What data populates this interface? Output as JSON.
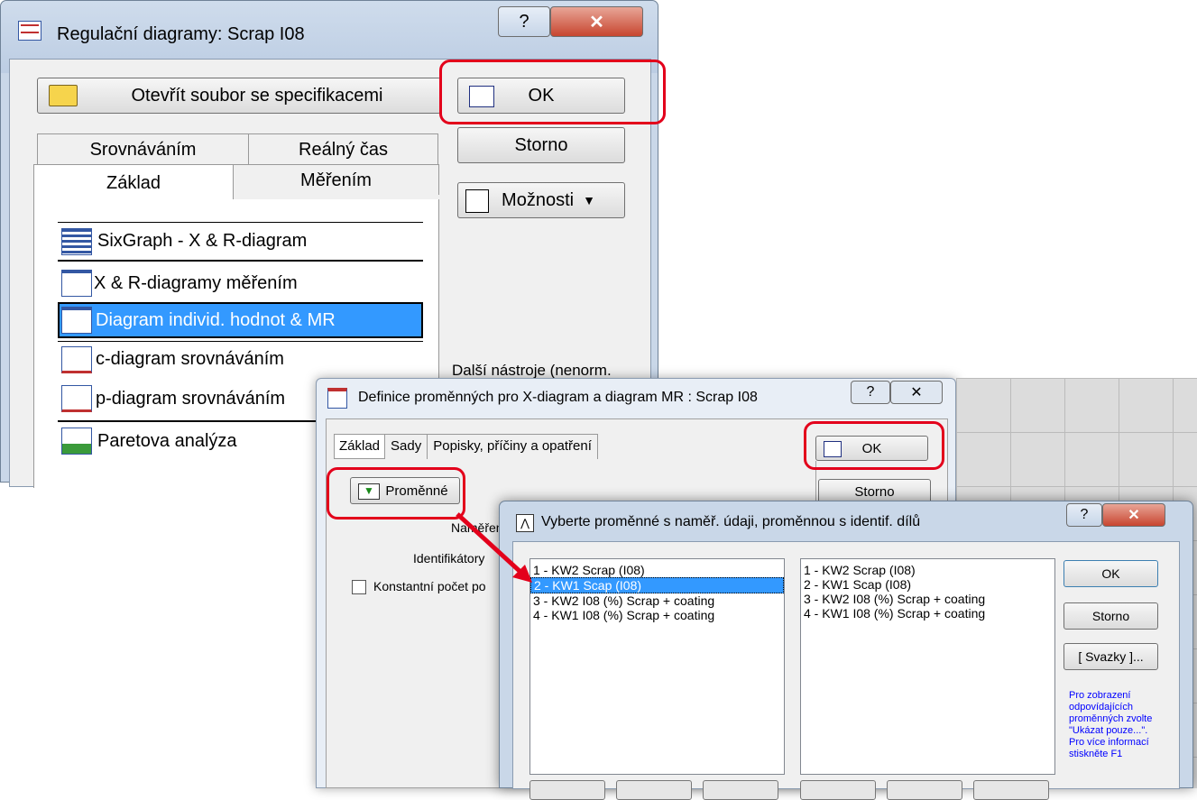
{
  "win1": {
    "title": "Regulační diagramy: Scrap I08",
    "open_file_button": "Otevřít soubor se specifikacemi",
    "ok_button": "OK",
    "cancel_button": "Storno",
    "options_button": "Možnosti",
    "tabs_back": [
      "Srovnáváním",
      "Reálný čas"
    ],
    "tabs_front": [
      "Základ",
      "Měřením"
    ],
    "list_items": [
      "SixGraph - X & R-diagram",
      "X & R-diagramy měřením",
      "Diagram individ. hodnot & MR",
      "c-diagram srovnáváním",
      "p-diagram srovnáváním",
      "Paretova analýza"
    ],
    "more_tools": "Další nástroje (nenorm."
  },
  "win2": {
    "title": "Definice proměnných pro X-diagram a diagram MR : Scrap I08",
    "tabs": [
      "Základ",
      "Sady",
      "Popisky, příčiny a opatření"
    ],
    "ok_button": "OK",
    "cancel_button": "Storno",
    "variables_button": "Proměnné",
    "measured_label_partial": "Naměřen",
    "identifiers_label_partial": "Identifikátory",
    "constant_checkbox_partial": "Konstantní počet po"
  },
  "win3": {
    "title": "Vyberte proměnné s naměř. údaji, proměnnou s identif. dílů",
    "left_list": [
      "1 - KW2 Scrap (I08)",
      "2 - KW1 Scap (I08)",
      "3 - KW2 I08 (%) Scrap + coating",
      "4 - KW1 I08 (%) Scrap + coating"
    ],
    "right_list": [
      "1 - KW2 Scrap (I08)",
      "2 - KW1 Scap (I08)",
      "3 - KW2 I08 (%) Scrap + coating",
      "4 - KW1 I08 (%) Scrap + coating"
    ],
    "ok_button": "OK",
    "cancel_button": "Storno",
    "bundles_button": "[ Svazky ]...",
    "help_text": "Pro zobrazení odpovídajících proměnných zvolte \"Ukázat pouze...\". Pro více informací stiskněte F1"
  },
  "colors": {
    "highlight_red": "#e3001b",
    "selection": "#3399ff",
    "help_blue": "#0000ff"
  }
}
